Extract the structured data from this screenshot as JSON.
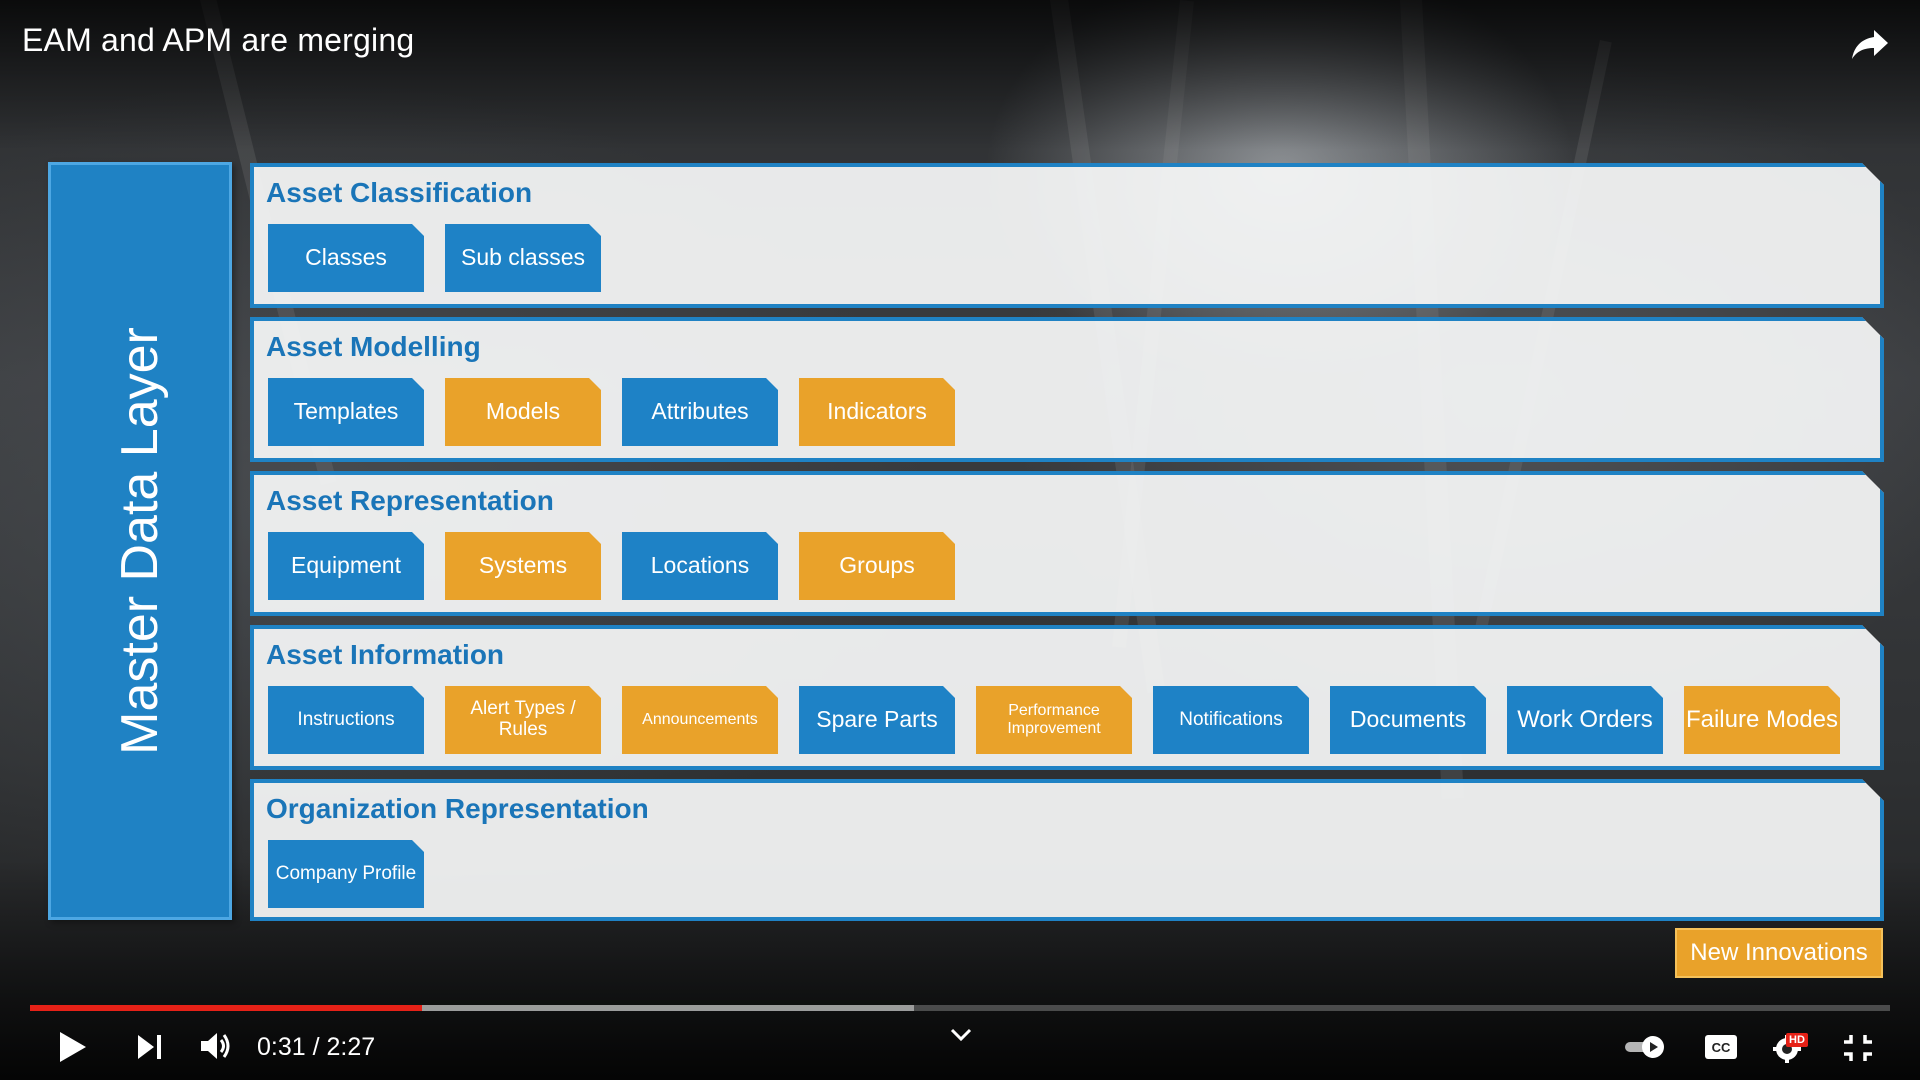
{
  "video": {
    "title": "EAM and APM are merging",
    "time_display": "0:31 / 2:27",
    "played_fraction": 0.211,
    "buffered_fraction": 0.475
  },
  "slide": {
    "master_label": "Master Data Layer",
    "panels": [
      {
        "title": "Asset Classification",
        "chips": [
          {
            "label": "Classes",
            "color": "blue"
          },
          {
            "label": "Sub classes",
            "color": "blue"
          }
        ]
      },
      {
        "title": "Asset Modelling",
        "chips": [
          {
            "label": "Templates",
            "color": "blue"
          },
          {
            "label": "Models",
            "color": "orange"
          },
          {
            "label": "Attributes",
            "color": "blue"
          },
          {
            "label": "Indicators",
            "color": "orange"
          }
        ]
      },
      {
        "title": "Asset Representation",
        "chips": [
          {
            "label": "Equipment",
            "color": "blue"
          },
          {
            "label": "Systems",
            "color": "orange"
          },
          {
            "label": "Locations",
            "color": "blue"
          },
          {
            "label": "Groups",
            "color": "orange"
          }
        ]
      },
      {
        "title": "Asset Information",
        "chips": [
          {
            "label": "Instructions",
            "color": "blue"
          },
          {
            "label": "Alert Types / Rules",
            "color": "orange"
          },
          {
            "label": "Announcements",
            "color": "orange"
          },
          {
            "label": "Spare Parts",
            "color": "blue"
          },
          {
            "label": "Performance Improvement",
            "color": "orange"
          },
          {
            "label": "Notifications",
            "color": "blue"
          },
          {
            "label": "Documents",
            "color": "blue"
          },
          {
            "label": "Work Orders",
            "color": "blue"
          },
          {
            "label": "Failure Modes",
            "color": "orange"
          }
        ]
      },
      {
        "title": "Organization Representation",
        "chips": [
          {
            "label": "Company Profile",
            "color": "blue"
          }
        ]
      }
    ],
    "badge": "New Innovations"
  },
  "colors": {
    "blue": "#1e82c6",
    "orange": "#e9a22a",
    "progress": "#e62117"
  },
  "controls": {
    "icons": [
      "share-icon",
      "play-icon",
      "next-icon",
      "volume-icon",
      "chevron-down-icon",
      "autoplay-toggle-icon",
      "captions-icon",
      "settings-icon",
      "exit-fullscreen-icon"
    ],
    "hd_badge": "HD"
  }
}
